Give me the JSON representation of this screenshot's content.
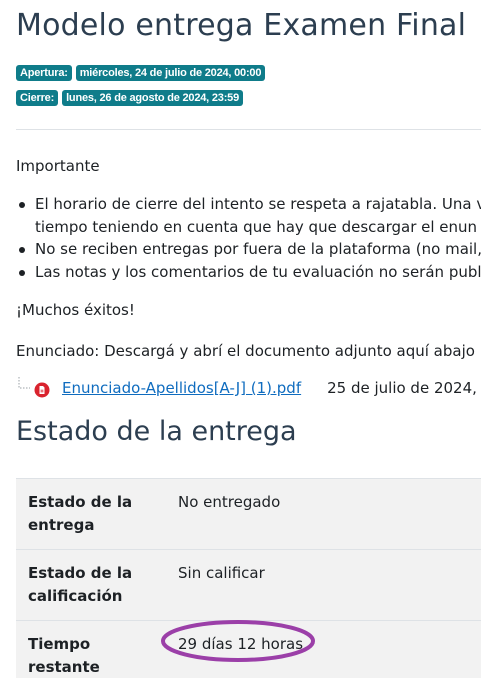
{
  "page": {
    "title": "Modelo entrega Examen Final"
  },
  "dates": [
    {
      "label": "Apertura:",
      "value": "miércoles, 24 de julio de 2024, 00:00"
    },
    {
      "label": "Cierre:",
      "value": "lunes, 26 de agosto de 2024, 23:59"
    }
  ],
  "description": {
    "heading": "Importante",
    "bullets": [
      "El horario de cierre del intento se respeta a rajatabla. Una ve",
      "tiempo teniendo en cuenta que hay que descargar el enun",
      "No se reciben entregas por fuera de la plataforma (no mail,",
      "Las notas y los comentarios de tu evaluación no serán publ"
    ],
    "closing": "¡Muchos éxitos!",
    "statement": "Enunciado: Descargá y abrí el documento adjunto aquí abajo"
  },
  "attachment": {
    "icon": "pdf-icon",
    "filename": "Enunciado-Apellidos[A-J] (1).pdf",
    "date": "25 de julio de 2024,"
  },
  "submission": {
    "title": "Estado de la entrega",
    "rows": [
      {
        "label": "Estado de la entrega",
        "value": "No entregado"
      },
      {
        "label": "Estado de la calificación",
        "value": "Sin calificar"
      },
      {
        "label": "Tiempo restante",
        "value": "29 días 12 horas"
      }
    ],
    "highlight_color": "#9b3fa8"
  },
  "colors": {
    "badge": "#0f7c8a",
    "link": "#0f6cbf",
    "pdf": "#d9232e"
  }
}
